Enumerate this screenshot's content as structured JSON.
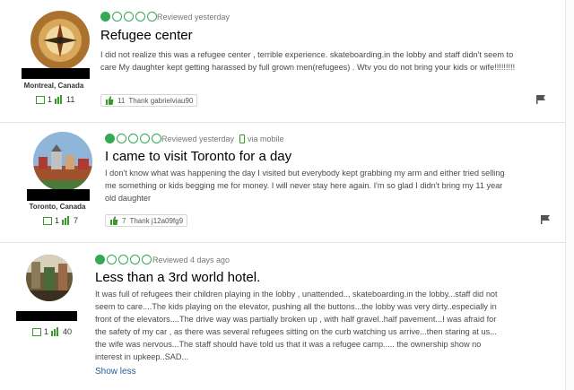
{
  "reviews": [
    {
      "location": "Montreal, Canada",
      "review_count": "1",
      "helpful_count": "11",
      "rating": 1,
      "date": "Reviewed yesterday",
      "via": "",
      "title": "Refugee center",
      "body": "I did not realize this was a refugee center , terrible experience. skateboarding.in the lobby and staff didn't seem to care My daughter kept getting harassed by full grown men(refugees) . Wtv you do not bring your kids or wife!!!!!!!!!",
      "thank_count": "11",
      "thank_label": "Thank gabrielviau90"
    },
    {
      "location": "Toronto, Canada",
      "review_count": "1",
      "helpful_count": "7",
      "rating": 1,
      "date": "Reviewed yesterday",
      "via": "via mobile",
      "title": "I came to visit Toronto for a day",
      "body": "I don't know what was happening the day I visited but everybody kept grabbing my arm and either tried selling me something or kids begging me for money. I will never stay here again. I'm so glad I didn't bring my 11 year old daughter",
      "thank_count": "7",
      "thank_label": "Thank j12a09fg9"
    },
    {
      "location": "",
      "review_count": "1",
      "helpful_count": "40",
      "rating": 1,
      "date": "Reviewed 4 days ago",
      "via": "",
      "title": "Less than a 3rd world hotel.",
      "body": "It was full of refugees their children playing in the lobby , unattended.., skateboarding.in the lobby...staff did not seem to care....The kids playing on the elevator, pushing all the buttons...the lobby was very dirty..especially in front of the elevators....The drive way was partially broken up , with half gravel..half pavement...I was afraid for the safety of my car , as there was several refugees sitting on the curb watching us arrive...then staring at us... the wife was nervous...The staff should have told us that it was a refugee camp..... the ownership show no interest in upkeep..SAD...",
      "show_less": "Show less"
    }
  ],
  "colors": {
    "rating_green": "#34a853",
    "link_blue": "#1a5e9a"
  }
}
